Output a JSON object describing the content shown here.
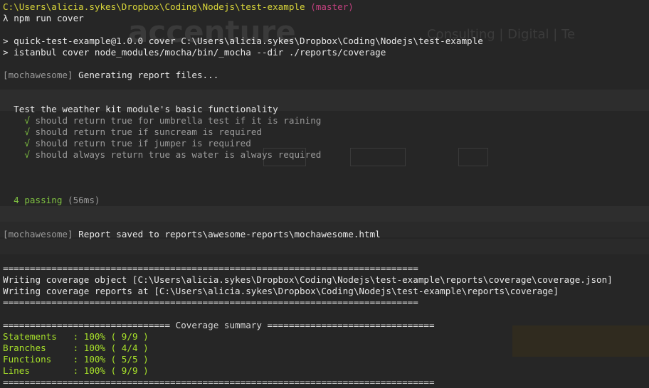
{
  "prompt": {
    "path": "C:\\Users\\alicia.sykes\\Dropbox\\Coding\\Nodejs\\test-example",
    "branch": "(master)",
    "lambda": "λ",
    "command": "npm run cover"
  },
  "script_lines": [
    "> quick-test-example@1.0.0 cover C:\\Users\\alicia.sykes\\Dropbox\\Coding\\Nodejs\\test-example",
    "> istanbul cover node_modules/mocha/bin/_mocha --dir ./reports/coverage"
  ],
  "mochawesome": {
    "tag": "[mochawesome]",
    "generating": " Generating report files...",
    "saved": " Report saved to reports\\awesome-reports\\mochawesome.html"
  },
  "suite": {
    "title": "Test the weather kit module's basic functionality",
    "check": "√",
    "tests": [
      "should return true for umbrella test if it is raining",
      "should return true if suncream is required",
      "should return true if jumper is required",
      "should always return true as water is always required"
    ],
    "passing": "4 passing",
    "duration": "(56ms)"
  },
  "coverage_write": {
    "rule_long": "=============================================================================",
    "object": "Writing coverage object [C:\\Users\\alicia.sykes\\Dropbox\\Coding\\Nodejs\\test-example\\reports\\coverage\\coverage.json]",
    "reports": "Writing coverage reports at [C:\\Users\\alicia.sykes\\Dropbox\\Coding\\Nodejs\\test-example\\reports\\coverage]"
  },
  "summary": {
    "header": "=============================== Coverage summary ===============================",
    "rows": [
      "Statements   : 100% ( 9/9 )",
      "Branches     : 100% ( 4/4 )",
      "Functions    : 100% ( 5/5 )",
      "Lines        : 100% ( 9/9 )"
    ],
    "footer": "================================================================================"
  },
  "colors": {
    "path": "#d9d63a",
    "branch": "#c2417f",
    "check": "#7fc241",
    "summary": "#a8e22a"
  }
}
